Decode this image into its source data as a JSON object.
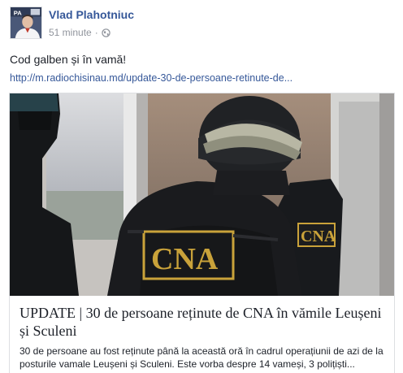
{
  "post": {
    "author": "Vlad Plahotniuc",
    "avatar_label": "PA",
    "time": "51 minute",
    "separator": "·",
    "privacy_icon": "globe-icon",
    "message": "Cod galben și în vamă!",
    "link_url": "http://m.radiochisinau.md/update-30-de-persoane-retinute-de..."
  },
  "attachment": {
    "image_icon": "photo-cna-officers",
    "badge_text": "CNA",
    "badge_text_2": "CNA",
    "title": "UPDATE | 30 de persoane reținute de CNA în vămile Leușeni și Sculeni",
    "description": "30 de persoane au fost reținute până la această oră în cadrul operațiunii de azi de la posturile vamale Leușeni și Sculeni. Este vorba despre 14 vameși, 3 polițiști..."
  },
  "colors": {
    "link": "#365899",
    "text": "#1d2129",
    "muted": "#90949c",
    "border": "#dddfe2",
    "badge": "#c9a23a"
  }
}
